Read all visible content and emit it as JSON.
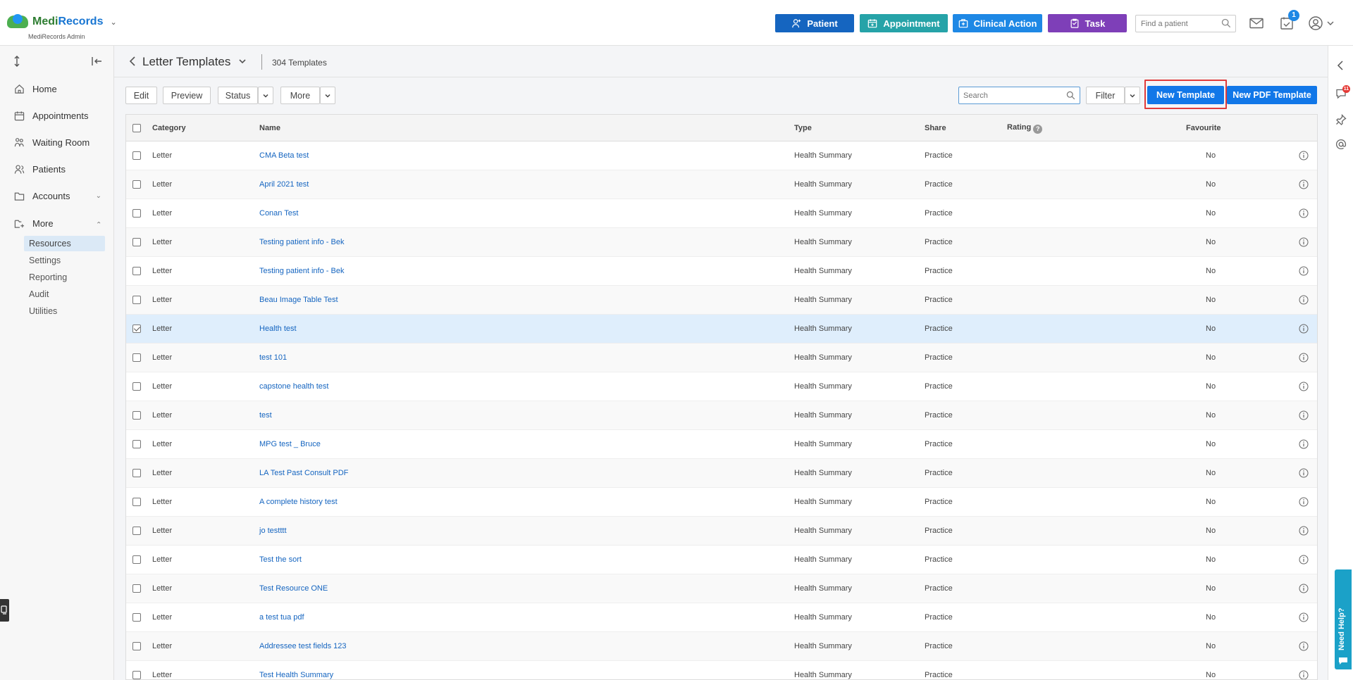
{
  "app": {
    "brand_part1": "Medi",
    "brand_part2": "Records",
    "subtitle": "MediRecords Admin"
  },
  "topbar": {
    "patient_label": "Patient",
    "appointment_label": "Appointment",
    "clinical_action_label": "Clinical Action",
    "task_label": "Task",
    "find_patient_placeholder": "Find a patient",
    "task_badge": "1",
    "colors": {
      "patient": "#1565c0",
      "appointment": "#26a3a8",
      "clinical_action": "#1e88e5",
      "task": "#7e3fb8"
    }
  },
  "sidebar": {
    "items": [
      {
        "label": "Home",
        "icon": "home-icon"
      },
      {
        "label": "Appointments",
        "icon": "calendar-icon"
      },
      {
        "label": "Waiting Room",
        "icon": "waiting-room-icon"
      },
      {
        "label": "Patients",
        "icon": "patients-icon"
      },
      {
        "label": "Accounts",
        "icon": "folder-icon"
      },
      {
        "label": "More",
        "icon": "more-folder-icon"
      }
    ],
    "sub_items": [
      "Resources",
      "Settings",
      "Reporting",
      "Audit",
      "Utilities"
    ],
    "active_sub": "Resources"
  },
  "page": {
    "title": "Letter Templates",
    "count": "304 Templates"
  },
  "toolbar": {
    "edit_label": "Edit",
    "preview_label": "Preview",
    "status_label": "Status",
    "more_label": "More",
    "search_placeholder": "Search",
    "filter_label": "Filter",
    "new_template_label": "New Template",
    "new_pdf_template_label": "New PDF Template"
  },
  "table": {
    "headers": {
      "category": "Category",
      "name": "Name",
      "type": "Type",
      "share": "Share",
      "rating": "Rating",
      "rating_help": "?",
      "favourite": "Favourite"
    },
    "rows": [
      {
        "category": "Letter",
        "name": "CMA Beta test",
        "type": "Health Summary",
        "share": "Practice",
        "favourite": "No",
        "checked": false
      },
      {
        "category": "Letter",
        "name": "April 2021 test",
        "type": "Health Summary",
        "share": "Practice",
        "favourite": "No",
        "checked": false
      },
      {
        "category": "Letter",
        "name": "Conan Test",
        "type": "Health Summary",
        "share": "Practice",
        "favourite": "No",
        "checked": false
      },
      {
        "category": "Letter",
        "name": "Testing patient info - Bek",
        "type": "Health Summary",
        "share": "Practice",
        "favourite": "No",
        "checked": false
      },
      {
        "category": "Letter",
        "name": "Testing patient info - Bek",
        "type": "Health Summary",
        "share": "Practice",
        "favourite": "No",
        "checked": false
      },
      {
        "category": "Letter",
        "name": "Beau Image Table Test",
        "type": "Health Summary",
        "share": "Practice",
        "favourite": "No",
        "checked": false
      },
      {
        "category": "Letter",
        "name": "Health test",
        "type": "Health Summary",
        "share": "Practice",
        "favourite": "No",
        "checked": true
      },
      {
        "category": "Letter",
        "name": "test 101",
        "type": "Health Summary",
        "share": "Practice",
        "favourite": "No",
        "checked": false
      },
      {
        "category": "Letter",
        "name": "capstone health test",
        "type": "Health Summary",
        "share": "Practice",
        "favourite": "No",
        "checked": false
      },
      {
        "category": "Letter",
        "name": "test",
        "type": "Health Summary",
        "share": "Practice",
        "favourite": "No",
        "checked": false
      },
      {
        "category": "Letter",
        "name": "MPG test _ Bruce",
        "type": "Health Summary",
        "share": "Practice",
        "favourite": "No",
        "checked": false
      },
      {
        "category": "Letter",
        "name": "LA Test Past Consult PDF",
        "type": "Health Summary",
        "share": "Practice",
        "favourite": "No",
        "checked": false
      },
      {
        "category": "Letter",
        "name": "A complete history test",
        "type": "Health Summary",
        "share": "Practice",
        "favourite": "No",
        "checked": false
      },
      {
        "category": "Letter",
        "name": "jo testttt",
        "type": "Health Summary",
        "share": "Practice",
        "favourite": "No",
        "checked": false
      },
      {
        "category": "Letter",
        "name": "Test the sort",
        "type": "Health Summary",
        "share": "Practice",
        "favourite": "No",
        "checked": false
      },
      {
        "category": "Letter",
        "name": "Test Resource ONE",
        "type": "Health Summary",
        "share": "Practice",
        "favourite": "No",
        "checked": false
      },
      {
        "category": "Letter",
        "name": "a test tua pdf",
        "type": "Health Summary",
        "share": "Practice",
        "favourite": "No",
        "checked": false
      },
      {
        "category": "Letter",
        "name": "Addressee test fields 123",
        "type": "Health Summary",
        "share": "Practice",
        "favourite": "No",
        "checked": false
      },
      {
        "category": "Letter",
        "name": "Test Health Summary",
        "type": "Health Summary",
        "share": "Practice",
        "favourite": "No",
        "checked": false
      }
    ]
  },
  "rightrail": {
    "notification_badge": "11",
    "need_help_label": "Need Help?"
  }
}
